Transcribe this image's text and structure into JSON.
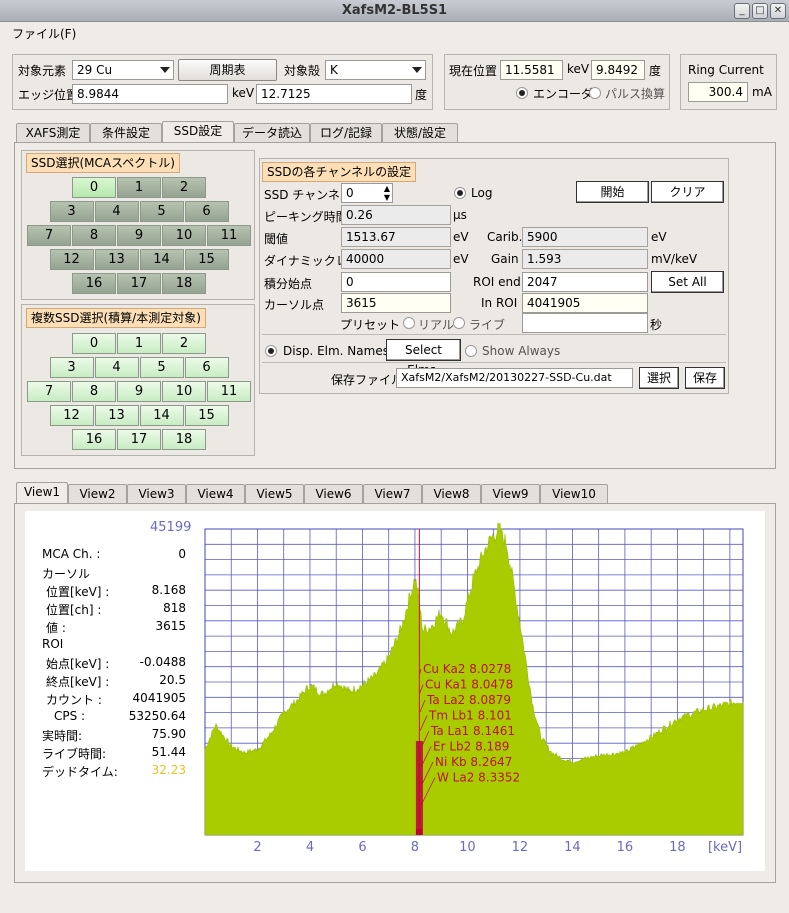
{
  "window": {
    "title": "XafsM2-BL5S1",
    "controls": [
      "_",
      "□",
      "✕"
    ]
  },
  "menu": {
    "file": "ファイル(F)"
  },
  "target": {
    "element_label": "対象元素",
    "element_value": "29 Cu",
    "periodic_btn": "周期表",
    "shell_label": "対象殻",
    "shell_value": "K",
    "edge_label": "エッジ位置",
    "edge_kev": "8.9844",
    "kev_unit": "keV",
    "edge_deg": "12.7125",
    "deg_unit": "度"
  },
  "position": {
    "label": "現在位置",
    "kev": "11.5581",
    "kev_unit": "keV",
    "deg": "9.8492",
    "deg_unit": "度",
    "encoder": "エンコーダ",
    "pulse": "パルス換算"
  },
  "ring": {
    "label": "Ring Current",
    "value": "300.4",
    "unit": "mA"
  },
  "tabs": [
    "XAFS測定",
    "条件設定",
    "SSD設定",
    "データ読込",
    "ログ/記録",
    "状態/設定"
  ],
  "ssd_select": {
    "caption": "SSD選択(MCAスペクトル)",
    "rows": [
      [
        "0",
        "1",
        "2"
      ],
      [
        "3",
        "4",
        "5",
        "6"
      ],
      [
        "7",
        "8",
        "9",
        "10",
        "11"
      ],
      [
        "12",
        "13",
        "14",
        "15"
      ],
      [
        "16",
        "17",
        "18"
      ]
    ]
  },
  "multi_select": {
    "caption": "複数SSD選択(積算/本測定対象)",
    "rows": [
      [
        "0",
        "1",
        "2"
      ],
      [
        "3",
        "4",
        "5",
        "6"
      ],
      [
        "7",
        "8",
        "9",
        "10",
        "11"
      ],
      [
        "12",
        "13",
        "14",
        "15"
      ],
      [
        "16",
        "17",
        "18"
      ]
    ]
  },
  "channel": {
    "caption": "SSDの各チャンネルの設定",
    "ssd_ch_label": "SSD チャンネル",
    "ssd_ch_value": "0",
    "log_label": "Log",
    "start_btn": "開始",
    "clear_btn": "クリア",
    "peaking_label": "ピーキング時間",
    "peaking_value": "0.26",
    "peaking_unit": "μs",
    "threshold_label": "閾値",
    "threshold_value": "1513.67",
    "threshold_unit": "eV",
    "carib_label": "Carib.",
    "carib_value": "5900",
    "carib_unit": "eV",
    "dynamic_label": "ダイナミックレンジ",
    "dynamic_value": "40000",
    "dynamic_unit": "eV",
    "gain_label": "Gain",
    "gain_value": "1.593",
    "gain_unit": "mV/keV",
    "integ_label": "積分始点",
    "integ_value": "0",
    "roi_end_label": "ROI end",
    "roi_end_value": "2047",
    "set_all_btn": "Set All",
    "cursor_label": "カーソル点",
    "cursor_value": "3615",
    "in_roi_label": "In ROI",
    "in_roi_value": "4041905",
    "preset_label": "プリセット",
    "real_label": "リアル",
    "live_label": "ライブ",
    "preset_value": "",
    "sec_unit": "秒",
    "disp_label": "Disp. Elm. Names",
    "select_elms_btn": "Select Elms.",
    "show_always_label": "Show Always",
    "save_file_label": "保存ファイル:",
    "save_file_value": "XafsM2/XafsM2/20130227-SSD-Cu.dat",
    "select_btn": "選択",
    "save_btn": "保存"
  },
  "view_tabs": [
    "View1",
    "View2",
    "View3",
    "View4",
    "View5",
    "View6",
    "View7",
    "View8",
    "View9",
    "View10"
  ],
  "stats": {
    "mca_ch_label": "MCA Ch. :",
    "mca_ch_value": "0",
    "cursor_section": "カーソル",
    "pos_kev_label": "位置[keV] :",
    "pos_kev_value": "8.168",
    "pos_ch_label": "位置[ch] :",
    "pos_ch_value": "818",
    "val_label": "値 :",
    "val_value": "3615",
    "roi_section": "ROI",
    "start_kev_label": "始点[keV] :",
    "start_kev_value": "-0.0488",
    "end_kev_label": "終点[keV] :",
    "end_kev_value": "20.5",
    "count_label": "カウント :",
    "count_value": "4041905",
    "cps_label": "CPS :",
    "cps_value": "53250.64",
    "real_time_label": "実時間:",
    "real_time_value": "75.90",
    "live_time_label": "ライブ時間:",
    "live_time_value": "51.44",
    "dead_time_label": "デッドタイム:",
    "dead_time_value": "32.23",
    "dead_time_color": "#f0c020"
  },
  "chart_data": {
    "type": "area",
    "ymax_label": "45199",
    "x_ticks": [
      "2",
      "4",
      "6",
      "8",
      "10",
      "12",
      "14",
      "16",
      "18"
    ],
    "x_unit": "[keV]",
    "xlim": [
      0,
      20.5
    ],
    "color": "#a8cc00",
    "cursor_kev": 8.168,
    "x": [
      0,
      0.4,
      1,
      1.5,
      2,
      2.5,
      3,
      3.5,
      4,
      4.5,
      5,
      5.5,
      6,
      6.5,
      7,
      7.5,
      7.8,
      8.0,
      8.1,
      8.3,
      8.6,
      9,
      9.4,
      9.8,
      10.2,
      10.6,
      10.9,
      11.2,
      11.5,
      11.8,
      12.1,
      12.5,
      12.8,
      13.2,
      13.6,
      14,
      15,
      16,
      17,
      18,
      19,
      20,
      20.5
    ],
    "y": [
      0.28,
      0.36,
      0.29,
      0.27,
      0.28,
      0.33,
      0.4,
      0.44,
      0.49,
      0.46,
      0.5,
      0.47,
      0.49,
      0.52,
      0.58,
      0.68,
      0.78,
      0.84,
      0.8,
      0.67,
      0.68,
      0.73,
      0.66,
      0.7,
      0.83,
      0.92,
      0.97,
      1.0,
      0.95,
      0.8,
      0.64,
      0.42,
      0.32,
      0.27,
      0.25,
      0.24,
      0.26,
      0.27,
      0.32,
      0.38,
      0.41,
      0.43,
      0.44
    ],
    "labels": [
      {
        "text": "Cu Ka2 8.0278"
      },
      {
        "text": "Cu Ka1 8.0478"
      },
      {
        "text": "Ta La2 8.0879"
      },
      {
        "text": "Tm Lb1 8.101"
      },
      {
        "text": "Ta La1 8.1461"
      },
      {
        "text": "Er Lb2 8.189"
      },
      {
        "text": "Ni Kb 8.2647"
      },
      {
        "text": "W La2 8.3352"
      }
    ]
  }
}
